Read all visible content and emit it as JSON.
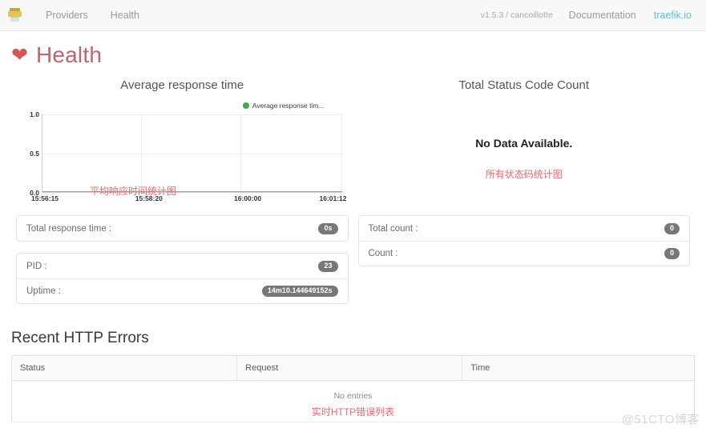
{
  "navbar": {
    "logo_icon": "traefik-logo-icon",
    "links": [
      {
        "label": "Providers"
      },
      {
        "label": "Health"
      }
    ],
    "version": "v1.5.3 / cancoillotte",
    "documentation_label": "Documentation",
    "site_label": "traefik.io",
    "link_color": "#5bc0de"
  },
  "page": {
    "heart_icon": "heart-icon",
    "title": "Health",
    "title_color": "#c0656a"
  },
  "left_panel": {
    "chart_title": "Average response time",
    "annotation_cn": "平均响应时间统计图",
    "stats": [
      {
        "label": "Total response time :",
        "value": "0s"
      }
    ],
    "process": [
      {
        "label": "PID :",
        "value": "23"
      },
      {
        "label": "Uptime :",
        "value": "14m10.144649152s"
      }
    ]
  },
  "right_panel": {
    "chart_title": "Total Status Code Count",
    "no_data_text": "No Data Available.",
    "annotation_cn": "所有状态码统计图",
    "stats": [
      {
        "label": "Total count :",
        "value": "0"
      },
      {
        "label": "Count :",
        "value": "0"
      }
    ]
  },
  "errors_section": {
    "title": "Recent HTTP Errors",
    "columns": [
      "Status",
      "Request",
      "Time"
    ],
    "empty_message": "No entries",
    "annotation_cn": "实时HTTP错误列表"
  },
  "watermark": "@51CTO博客",
  "chart_data": {
    "type": "line",
    "title": "Average response time",
    "xlabel": "",
    "ylabel": "",
    "legend": [
      "Average response tim..."
    ],
    "legend_position": "top-right",
    "series_color": "#3eae49",
    "grid": true,
    "x_ticks": [
      "15:56:15",
      "15:58:20",
      "16:00:00",
      "16:01:12"
    ],
    "y_ticks": [
      "0.0",
      "0.5",
      "1.0"
    ],
    "ylim": [
      0,
      1
    ],
    "series": [
      {
        "name": "Average response tim...",
        "values": [
          0,
          0,
          0,
          0
        ]
      }
    ]
  }
}
